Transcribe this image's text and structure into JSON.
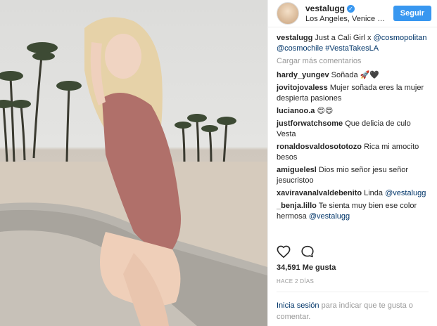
{
  "post": {
    "username": "vestalugg",
    "verified_icon": "verified-badge-icon",
    "location": "Los Angeles, Venice Be...",
    "follow_label": "Seguir",
    "caption_user": "vestalugg",
    "caption_text": "Just a Cali Girl x",
    "caption_tag1": "@cosmopolitan",
    "caption_tag2": "@cosmochile",
    "caption_tag3": "#VestaTakesLA",
    "load_more": "Cargar más comentarios",
    "likes": "34,591 Me gusta",
    "time_ago": "HACE 2 DÍAS",
    "login_link": "Inicia sesión",
    "login_rest": "para indicar que te gusta o comentar."
  },
  "comments": [
    {
      "user": "hardy_yungev",
      "text": "Soñada 🚀🖤"
    },
    {
      "user": "jovitojovaless",
      "text": "Mujer soñada eres la mujer despierta pasiones"
    },
    {
      "user": "lucianoo.a",
      "text": "😍😍"
    },
    {
      "user": "justforwatchsome",
      "text": "Que delicia de culo Vesta"
    },
    {
      "user": "ronaldosvaldosototozo",
      "text": "Rica mi amocito besos"
    },
    {
      "user": "amiguelesl",
      "text": "Dios mio señor jesu señor jesucristoo"
    },
    {
      "user": "xaviravanalvaldebenito",
      "text": "Linda",
      "tag": "@vestalugg"
    },
    {
      "user": "_benja.lillo",
      "text": "Te sienta muy bien ese color hermosa",
      "tag": "@vestalugg"
    }
  ],
  "colors": {
    "accent": "#3897f0",
    "link": "#003569",
    "muted": "#999999",
    "swimsuit": "#b0706a"
  },
  "icons": [
    "heart-icon",
    "comment-icon"
  ]
}
